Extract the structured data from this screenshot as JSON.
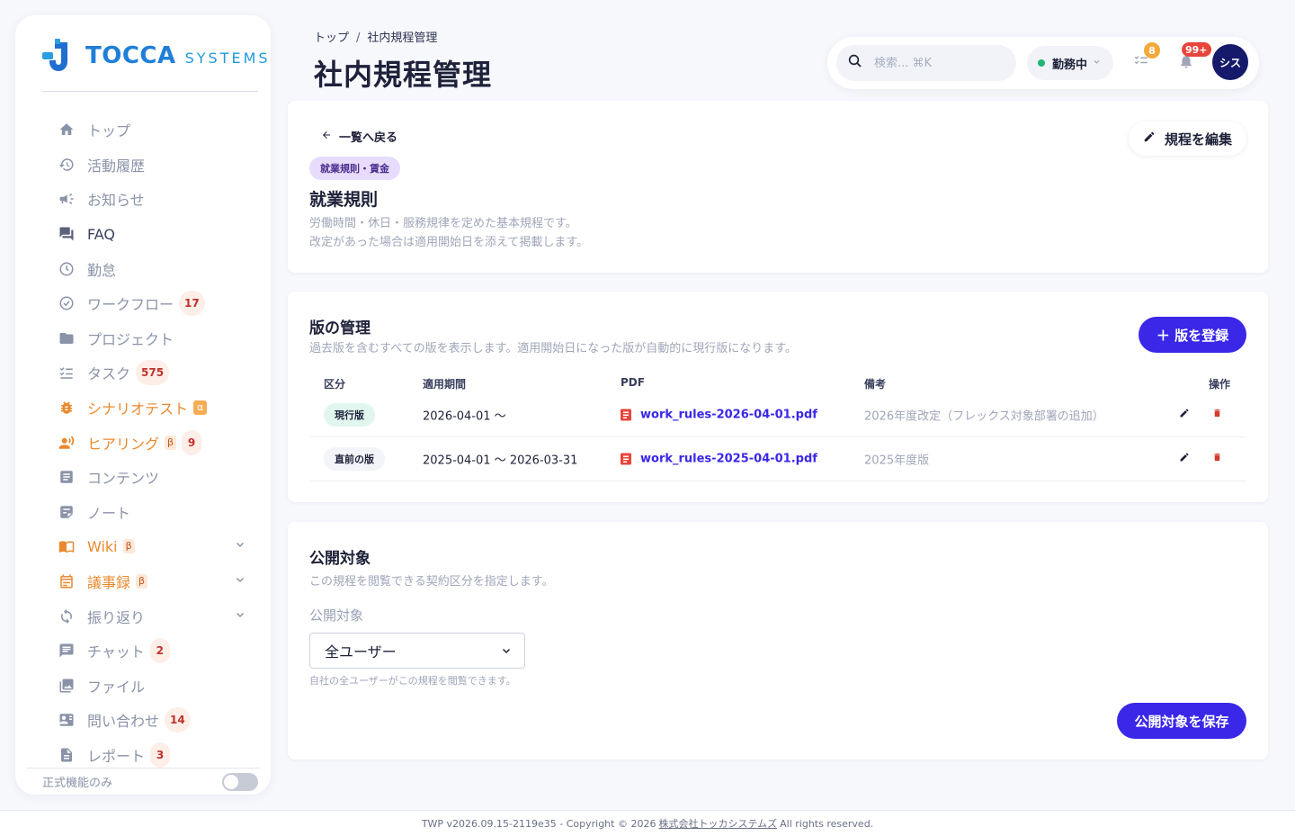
{
  "brand": {
    "name_bold": "TOCCA",
    "name_light": "SYSTEMS",
    "colors": {
      "primary": "#1f7fd8",
      "accent": "#3a27e8"
    }
  },
  "sidebar": {
    "items": [
      {
        "label": "トップ",
        "icon": "home-icon"
      },
      {
        "label": "活動履歴",
        "icon": "history-icon"
      },
      {
        "label": "お知らせ",
        "icon": "megaphone-icon"
      },
      {
        "label": "FAQ",
        "icon": "chat-bubbles-icon"
      },
      {
        "label": "勤怠",
        "icon": "clock-icon"
      },
      {
        "label": "ワークフロー",
        "icon": "check-circle-icon",
        "badge": "17"
      },
      {
        "label": "プロジェクト",
        "icon": "folder-icon"
      },
      {
        "label": "タスク",
        "icon": "checklist-icon",
        "badge": "575"
      },
      {
        "label": "シナリオテスト",
        "icon": "bug-icon",
        "tag": "α"
      },
      {
        "label": "ヒアリング",
        "icon": "interview-icon",
        "tag": "β",
        "badge": "9"
      },
      {
        "label": "コンテンツ",
        "icon": "document-icon"
      },
      {
        "label": "ノート",
        "icon": "note-icon"
      },
      {
        "label": "Wiki",
        "icon": "book-icon",
        "tag": "β"
      },
      {
        "label": "議事録",
        "icon": "calendar-icon",
        "tag": "β"
      },
      {
        "label": "振り返り",
        "icon": "refresh-icon"
      },
      {
        "label": "チャット",
        "icon": "chat-icon",
        "badge": "2"
      },
      {
        "label": "ファイル",
        "icon": "image-icon"
      },
      {
        "label": "問い合わせ",
        "icon": "contact-card-icon",
        "badge": "14"
      },
      {
        "label": "レポート",
        "icon": "report-icon",
        "badge": "3"
      }
    ],
    "bottom_label": "正式機能のみ"
  },
  "header": {
    "breadcrumb": {
      "home": "トップ",
      "separator": "/",
      "current": "社内規程管理"
    },
    "title": "社内規程管理",
    "search_placeholder": "検索... ⌘K",
    "status_label": "勤務中",
    "tasks_badge": "8",
    "notifications_badge": "99+",
    "avatar_text": "シス"
  },
  "rule": {
    "back_label": "一覧へ戻る",
    "edit_label": "規程を編集",
    "category": "就業規則・賃金",
    "title": "就業規則",
    "description_line1": "労働時間・休日・服務規律を定めた基本規程です。",
    "description_line2": "改定があった場合は適用開始日を添えて掲載します。"
  },
  "versions": {
    "title": "版の管理",
    "subtitle": "過去版を含むすべての版を表示します。適用開始日になった版が自動的に現行版になります。",
    "register_label": "＋ 版を登録",
    "columns": {
      "kind": "区分",
      "period": "適用期間",
      "pdf": "PDF",
      "note": "備考",
      "actions": "操作"
    },
    "rows": [
      {
        "kind": "現行版",
        "period": "2026-04-01 〜",
        "pdf": "work_rules-2026-04-01.pdf",
        "note": "2026年度改定（フレックス対象部署の追加）"
      },
      {
        "kind": "直前の版",
        "period": "2025-04-01 〜 2026-03-31",
        "pdf": "work_rules-2025-04-01.pdf",
        "note": "2025年度版"
      }
    ]
  },
  "audience": {
    "title": "公開対象",
    "subtitle": "この規程を閲覧できる契約区分を指定します。",
    "field_label": "公開対象",
    "selected": "全ユーザー",
    "helper": "自社の全ユーザーがこの規程を閲覧できます。",
    "save_label": "公開対象を保存"
  },
  "footer": {
    "prefix": "TWP v2026.09.15-2119e35 - Copyright © 2026",
    "company": "株式会社トッカシステムズ",
    "suffix": "All rights reserved."
  }
}
